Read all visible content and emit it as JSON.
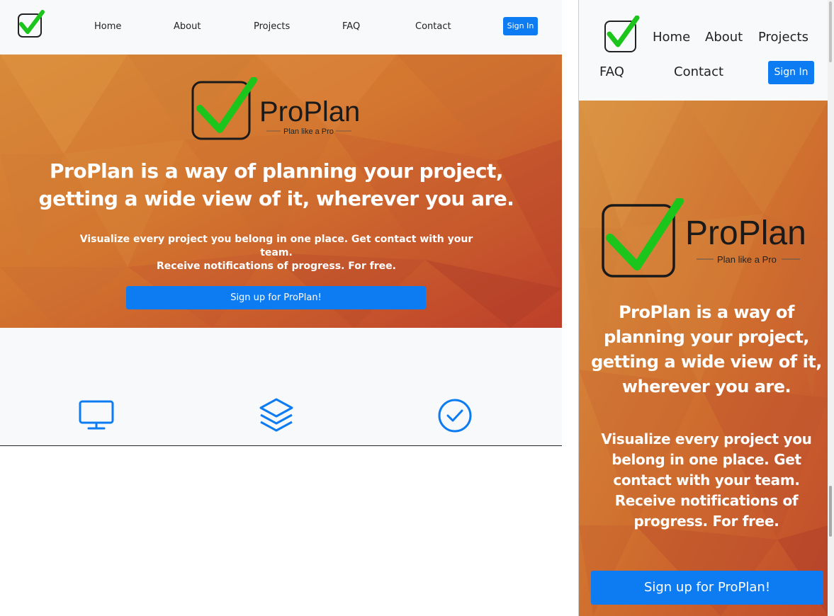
{
  "brand": {
    "name": "ProPlan",
    "tagline": "Plan like a Pro"
  },
  "nav": {
    "links": [
      "Home",
      "About",
      "Projects",
      "FAQ",
      "Contact"
    ],
    "signin_label": "Sign In"
  },
  "hero": {
    "headline_line1": "ProPlan is a way of planning your project,",
    "headline_line2": "getting a wide view of it, wherever you are.",
    "sub_line1": "Visualize every project you belong in one place. Get contact with your team.",
    "sub_line2": "Receive notifications of progress. For free.",
    "cta_label": "Sign up for ProPlan!"
  },
  "features": [
    {
      "icon": "monitor-icon"
    },
    {
      "icon": "layers-icon"
    },
    {
      "icon": "check-circle-icon"
    }
  ],
  "mobile": {
    "headline": "ProPlan is a way of planning your project, getting a wide view of it, wherever you are.",
    "sub": "Visualize every project you belong in one place. Get contact with your team. Receive notifications of progress. For free."
  },
  "colors": {
    "primary": "#0d7cf2",
    "check_green": "#1cc51c",
    "hero_orange": "#d3752f",
    "hero_red": "#c0432a"
  }
}
